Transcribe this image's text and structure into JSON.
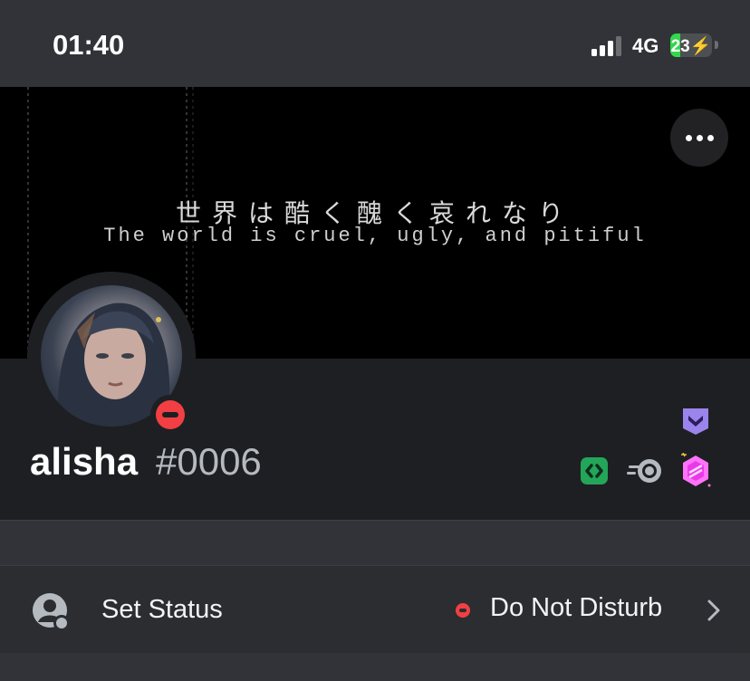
{
  "status_bar": {
    "time": "01:40",
    "network": "4G",
    "battery": "23"
  },
  "banner": {
    "text_jp": "世界は酷く醜く哀れなり",
    "text_en": "The world is cruel, ugly, and pitiful"
  },
  "profile": {
    "username": "alisha",
    "discriminator": "#0006",
    "status": "dnd",
    "badges": [
      "hypesquad-icon",
      "active-developer-icon",
      "nitro-icon",
      "boost-icon"
    ]
  },
  "status_row": {
    "label": "Set Status",
    "value": "Do Not Disturb"
  },
  "colors": {
    "dnd": "#f23f43",
    "hypesquad": "#9b84ec",
    "active_dev": "#23a55a",
    "boost": "#ff73fa"
  }
}
